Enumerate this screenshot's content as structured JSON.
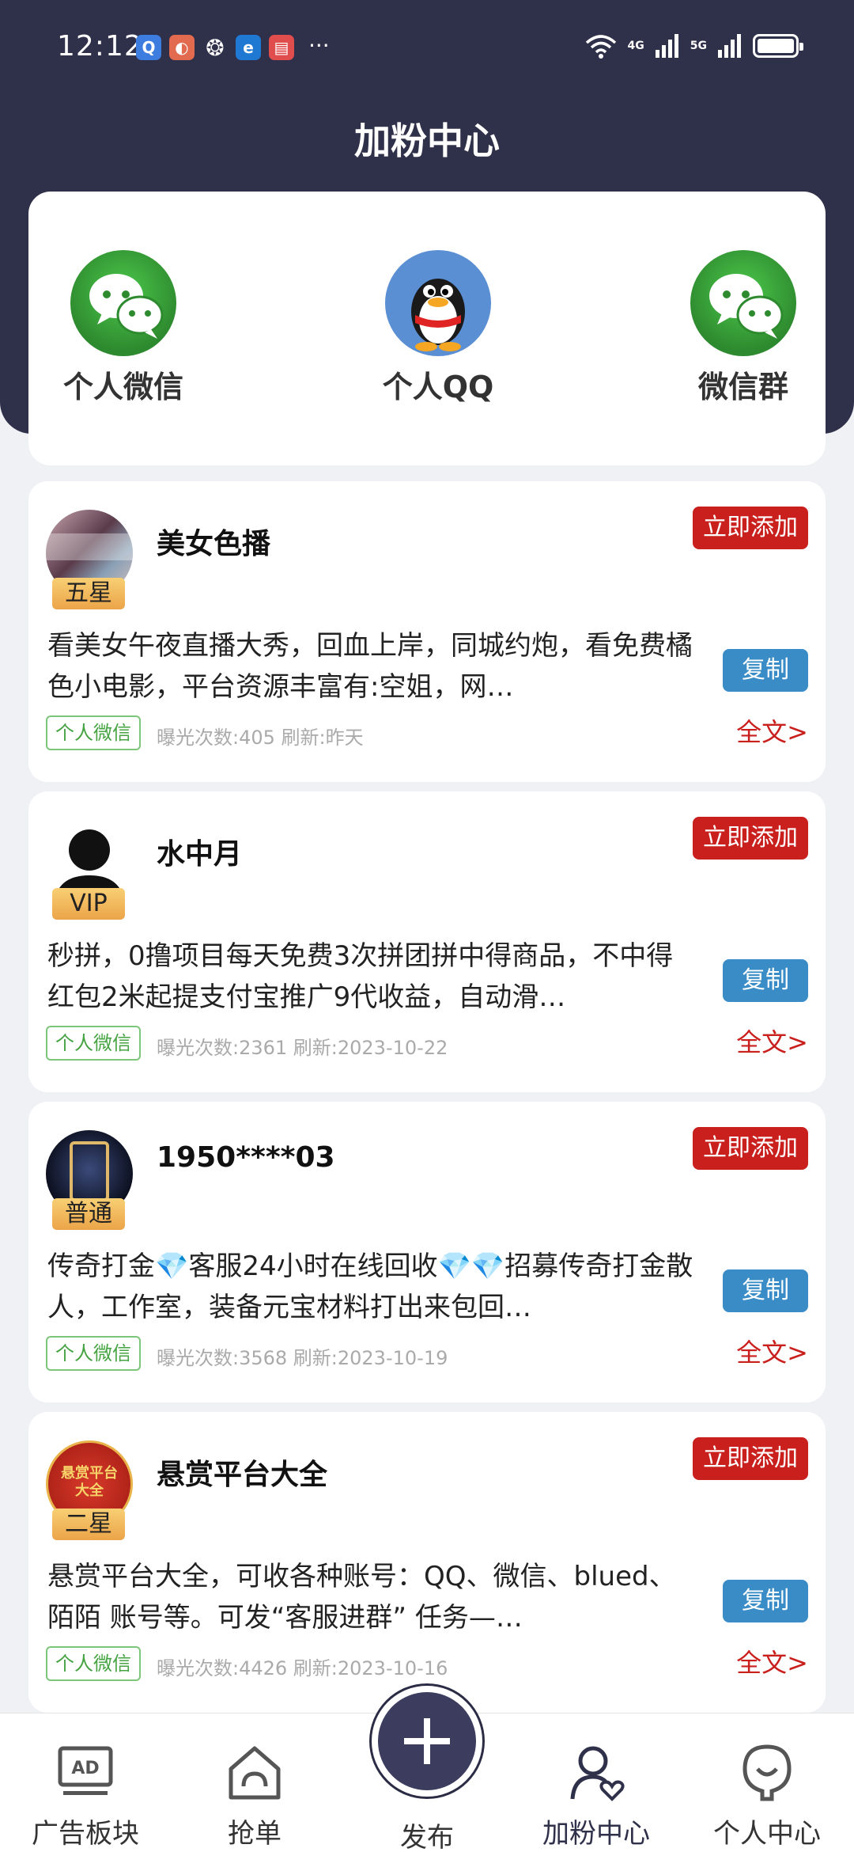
{
  "status": {
    "time": "12:12",
    "net1": "4G",
    "net2": "5G",
    "more": "···"
  },
  "header": {
    "title": "加粉中心"
  },
  "categories": [
    {
      "label": "个人微信",
      "icon": "wechat-icon"
    },
    {
      "label": "个人QQ",
      "icon": "qq-penguin-icon"
    },
    {
      "label": "微信群",
      "icon": "wechat-group-icon"
    }
  ],
  "cards": [
    {
      "name": "美女色播",
      "level": "五星",
      "add_label": "立即添加",
      "description": "看美女午夜直播大秀，回血上岸，同城约炮，看免费橘色小电影，平台资源丰富有:空姐，网…",
      "copy_label": "复制",
      "tag": "个人微信",
      "meta": "曝光次数:405 刷新:昨天",
      "full_label": "全文>"
    },
    {
      "name": "水中月",
      "level": "VIP",
      "add_label": "立即添加",
      "description": "秒拼，0撸项目每天免费3次拼团拼中得商品，不中得红包2米起提支付宝推广9代收益，自动滑…",
      "copy_label": "复制",
      "tag": "个人微信",
      "meta": "曝光次数:2361 刷新:2023-10-22",
      "full_label": "全文>"
    },
    {
      "name": "1950****03",
      "level": "普通",
      "add_label": "立即添加",
      "description": "传奇打金💎客服24小时在线回收💎💎招募传奇打金散人，工作室，装备元宝材料打出来包回…",
      "copy_label": "复制",
      "tag": "个人微信",
      "meta": "曝光次数:3568 刷新:2023-10-19",
      "full_label": "全文>"
    },
    {
      "name": "悬赏平台大全",
      "level": "二星",
      "add_label": "立即添加",
      "description": "悬赏平台大全，可收各种账号：QQ、微信、blued、陌陌 账号等。可发“客服进群” 任务—…",
      "copy_label": "复制",
      "tag": "个人微信",
      "meta": "曝光次数:4426 刷新:2023-10-16",
      "full_label": "全文>"
    }
  ],
  "avatar4_text": "悬赏平台大全",
  "tabs": [
    {
      "label": "广告板块",
      "icon": "ad-board-icon"
    },
    {
      "label": "抢单",
      "icon": "home-grab-icon"
    },
    {
      "label": "发布",
      "icon": "plus-icon"
    },
    {
      "label": "加粉中心",
      "icon": "user-heart-icon"
    },
    {
      "label": "个人中心",
      "icon": "profile-icon"
    }
  ],
  "colors": {
    "header_bg": "#2f3049",
    "accent_red": "#c9201d",
    "copy_blue": "#3a8cc6",
    "tag_green": "#45a342",
    "badge_gold": "#f0b050"
  }
}
